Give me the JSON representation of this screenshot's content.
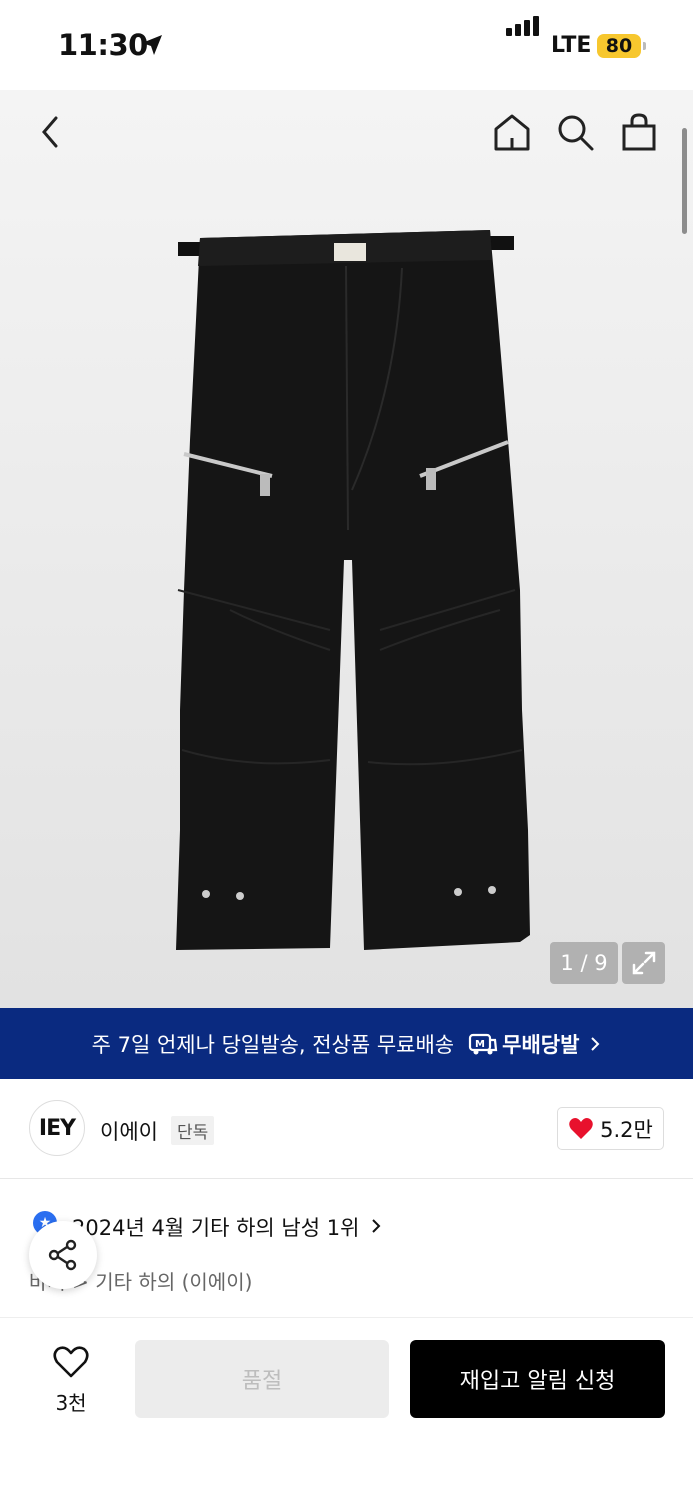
{
  "status_bar": {
    "time": "11:30",
    "network": "LTE",
    "battery": "80"
  },
  "colors": {
    "banner": "#0a2a80",
    "battery": "#f7c72e",
    "heart": "#e8112d",
    "rank_icon": "#2a6ef0"
  },
  "top_nav": {
    "back_icon": "chevron-left-icon",
    "home_icon": "home-icon",
    "search_icon": "search-icon",
    "cart_icon": "shopping-bag-icon"
  },
  "gallery": {
    "page_indicator": "1 / 9",
    "expand_icon": "expand-icon"
  },
  "banner": {
    "text": "주 7일 언제나 당일발송, 전상품 무료배송",
    "badge": "무배당발"
  },
  "brand": {
    "logo": "IEY",
    "name": "이에이",
    "tag": "단독",
    "likes": "5.2만"
  },
  "ranking": {
    "text": "2024년 4월 기타 하의 남성 1위",
    "category_path": "바지 > 기타 하의 (이에이)"
  },
  "bottom_bar": {
    "wish_count": "3천",
    "soldout_label": "품절",
    "restock_label": "재입고 알림 신청"
  }
}
